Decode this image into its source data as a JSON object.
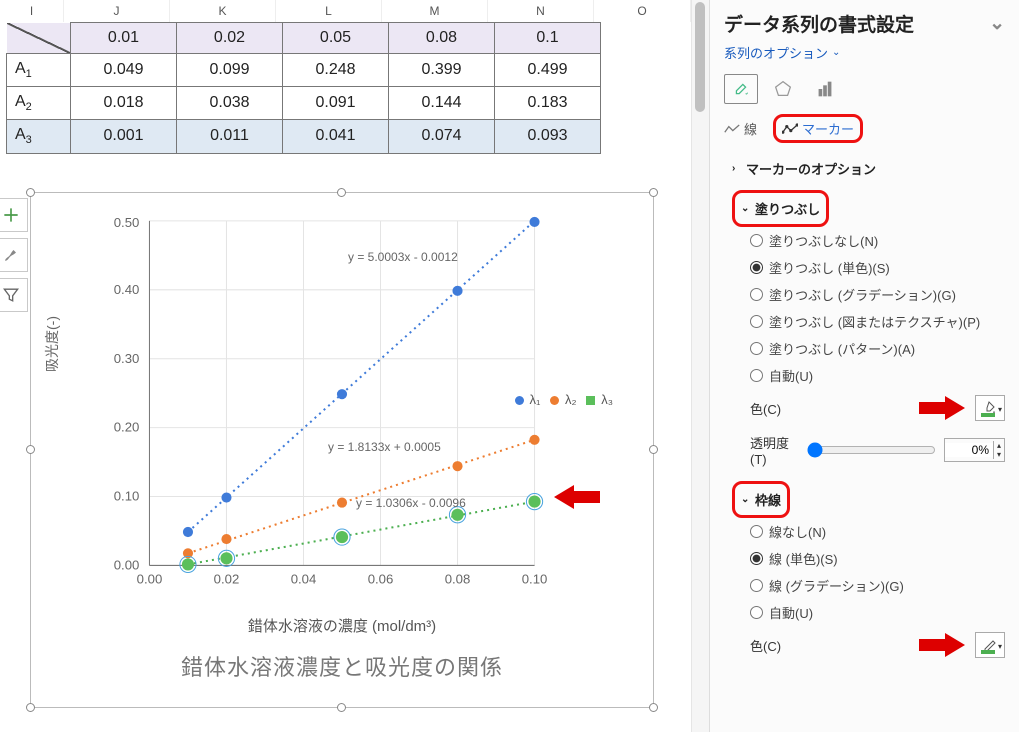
{
  "columns_labels": {
    "I": "I",
    "J": "J",
    "K": "K",
    "L": "L",
    "M": "M",
    "N": "N",
    "O": "O"
  },
  "sheet": {
    "row_labels": {
      "A1": "A",
      "A1_sub": "1",
      "A2": "A",
      "A2_sub": "2",
      "A3": "A",
      "A3_sub": "3"
    },
    "header": {
      "J": "0.01",
      "K": "0.02",
      "L": "0.05",
      "M": "0.08",
      "N": "0.1"
    },
    "rows": {
      "A1": {
        "J": "0.049",
        "K": "0.099",
        "L": "0.248",
        "M": "0.399",
        "N": "0.499"
      },
      "A2": {
        "J": "0.018",
        "K": "0.038",
        "L": "0.091",
        "M": "0.144",
        "N": "0.183"
      },
      "A3": {
        "J": "0.001",
        "K": "0.011",
        "L": "0.041",
        "M": "0.074",
        "N": "0.093"
      }
    }
  },
  "chart": {
    "ylabel": "吸光度(-)",
    "xlabel": "錯体水溶液の濃度 (mol/dm³)",
    "title": "錯体水溶液濃度と吸光度の関係",
    "legend": {
      "l1": "λ₁",
      "l2": "λ₂",
      "l3": "λ₃"
    },
    "equations": {
      "s1": "y = 5.0003x - 0.0012",
      "s2": "y = 1.8133x + 0.0005",
      "s3": "y = 1.0306x - 0.0096"
    },
    "xticks": {
      "t0": "0.00",
      "t1": "0.02",
      "t2": "0.04",
      "t3": "0.06",
      "t4": "0.08",
      "t5": "0.10"
    },
    "yticks": {
      "t0": "0.00",
      "t1": "0.10",
      "t2": "0.20",
      "t3": "0.30",
      "t4": "0.40",
      "t5": "0.50"
    },
    "colors": {
      "s1": "#3f7bd9",
      "s2": "#ed7d31",
      "s3": "#4caf50"
    }
  },
  "chart_data": {
    "type": "scatter",
    "title": "錯体水溶液濃度と吸光度の関係",
    "xlabel": "錯体水溶液の濃度 (mol/dm³)",
    "ylabel": "吸光度(-)",
    "xlim": [
      0.0,
      0.1
    ],
    "ylim": [
      0.0,
      0.5
    ],
    "x": [
      0.01,
      0.02,
      0.05,
      0.08,
      0.1
    ],
    "series": [
      {
        "name": "λ₁",
        "values": [
          0.049,
          0.099,
          0.248,
          0.399,
          0.499
        ],
        "trendline": "y = 5.0003x - 0.0012"
      },
      {
        "name": "λ₂",
        "values": [
          0.018,
          0.038,
          0.091,
          0.144,
          0.183
        ],
        "trendline": "y = 1.8133x + 0.0005"
      },
      {
        "name": "λ₃",
        "values": [
          0.001,
          0.011,
          0.041,
          0.074,
          0.093
        ],
        "trendline": "y = 1.0306x - 0.0096"
      }
    ]
  },
  "pane": {
    "title": "データ系列の書式設定",
    "options_label": "系列のオプション",
    "tabs": {
      "line": "線",
      "marker": "マーカー"
    },
    "marker_options": "マーカーのオプション",
    "fill": {
      "title": "塗りつぶし",
      "none": "塗りつぶしなし(N)",
      "solid": "塗りつぶし (単色)(S)",
      "gradient": "塗りつぶし (グラデーション)(G)",
      "picture": "塗りつぶし (図またはテクスチャ)(P)",
      "pattern": "塗りつぶし (パターン)(A)",
      "auto": "自動(U)",
      "color_label": "色(C)",
      "transparency_label": "透明度(T)",
      "transparency_value": "0%"
    },
    "border": {
      "title": "枠線",
      "none": "線なし(N)",
      "solid": "線 (単色)(S)",
      "gradient": "線 (グラデーション)(G)",
      "auto": "自動(U)",
      "color_label": "色(C)"
    }
  }
}
